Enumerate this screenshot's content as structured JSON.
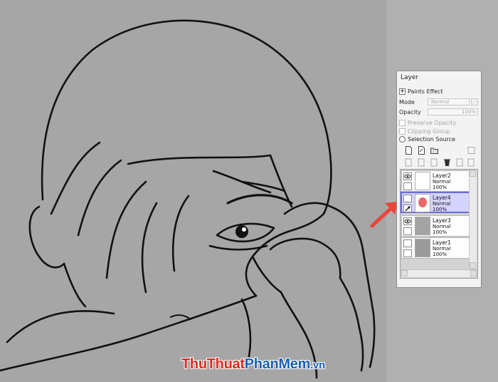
{
  "panel": {
    "title": "Layer",
    "paints_effect_label": "Paints Effect",
    "mode_label": "Mode",
    "mode_value": "Normal",
    "opacity_label": "Opacity",
    "opacity_value": "100%",
    "preserve_opacity_label": "Preserve Opacity",
    "clipping_group_label": "Clipping Group",
    "selection_source_label": "Selection Source"
  },
  "tools": [
    "new-layer-icon",
    "new-vector-layer-icon",
    "new-folder-icon",
    "transfer-down-icon",
    "merge-down-icon",
    "clear-layer-icon",
    "delete-layer-icon",
    "layer-properties-icon"
  ],
  "layers": [
    {
      "name": "Layer2",
      "mode": "Normal",
      "opacity": "100%",
      "visible": true
    },
    {
      "name": "Layer4",
      "mode": "Normal",
      "opacity": "100%",
      "visible": false,
      "selected": true
    },
    {
      "name": "Layer3",
      "mode": "Normal",
      "opacity": "100%",
      "visible": true
    },
    {
      "name": "Layer1",
      "mode": "Normal",
      "opacity": "100%",
      "visible": false
    }
  ],
  "colors": {
    "canvas_bg": "#a6a6a6",
    "selected_layer": "#d4d4ff",
    "arrow": "#e8463a",
    "thumb_red": "#e86a6a"
  },
  "watermark": {
    "part1": "ThuThuat",
    "part2": "PhanMem",
    "part3": ".vn"
  }
}
